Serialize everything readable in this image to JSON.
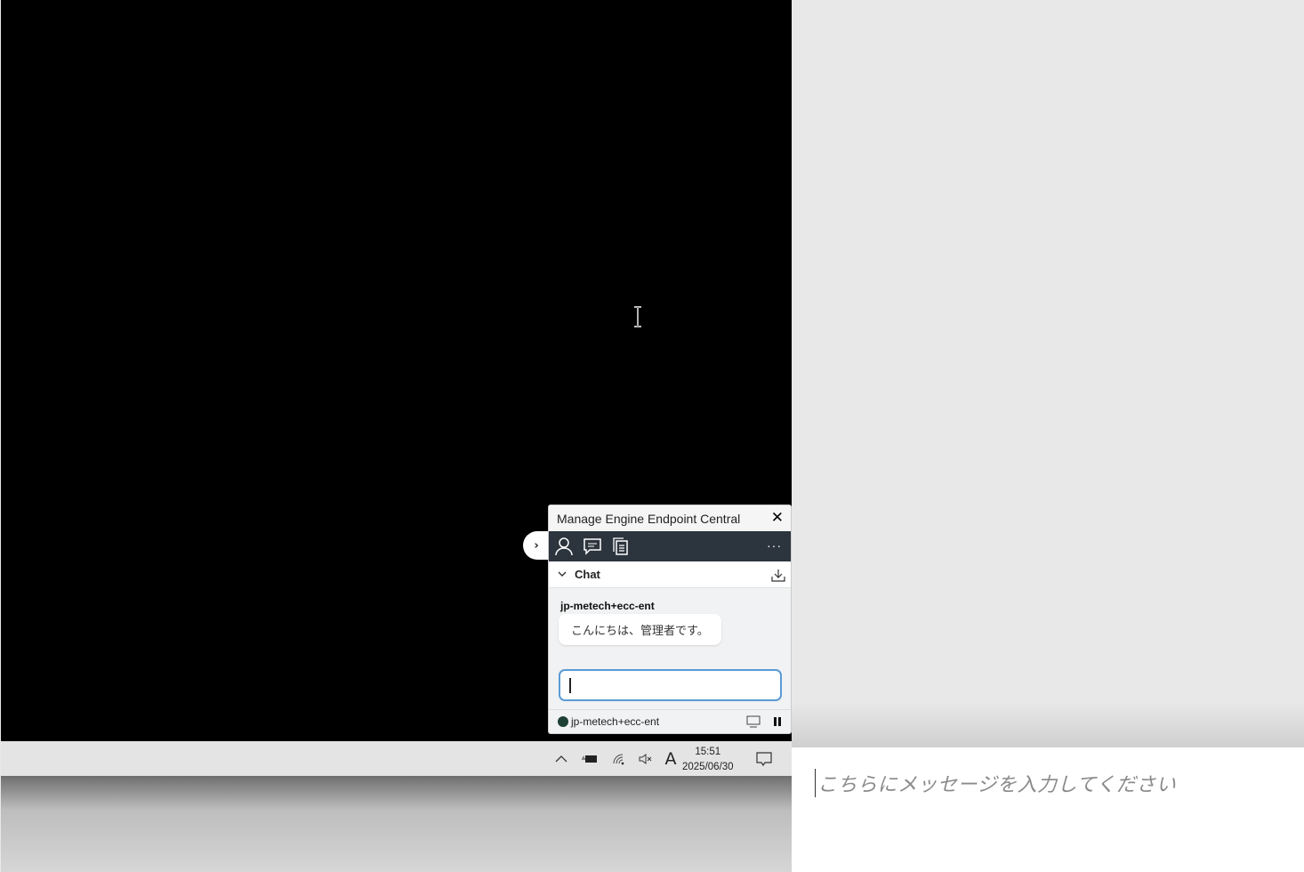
{
  "remote_panel": {
    "title": "Manage Engine Endpoint Central",
    "toolbar_icons": [
      "user-icon",
      "chat-icon",
      "clipboard-icon",
      "more-icon"
    ],
    "more_label": "···",
    "chat_section": {
      "label": "Chat"
    },
    "messages": [
      {
        "sender": "jp-metech+ecc-ent",
        "text": "こんにちは、管理者です。"
      }
    ],
    "chat_input_value": "",
    "footer": {
      "user": "jp-metech+ecc-ent",
      "status_color": "#1e4034"
    }
  },
  "taskbar": {
    "time": "15:51",
    "date": "2025/06/30",
    "ime_label": "A"
  },
  "message_box": {
    "placeholder": "こちらにメッセージを入力してください"
  }
}
